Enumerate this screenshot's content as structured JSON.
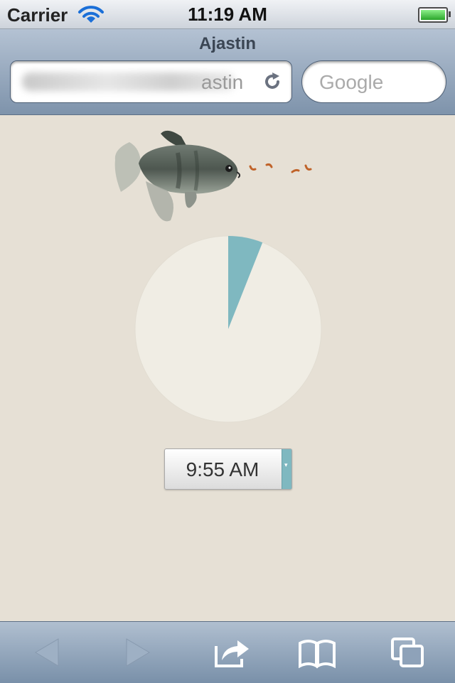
{
  "status_bar": {
    "carrier": "Carrier",
    "time": "11:19 AM",
    "icons": [
      "wifi-icon",
      "battery-icon"
    ]
  },
  "browser": {
    "page_title": "Ajastin",
    "address": {
      "visible_text": "astin",
      "icon": "reload-icon"
    },
    "search": {
      "placeholder": "Google"
    }
  },
  "app": {
    "illustration": "fish-eating-food",
    "timer": {
      "fraction_elapsed": 0.06,
      "remaining_color": "#f0ede4",
      "elapsed_color": "#7fb8c0"
    },
    "time_select": {
      "value": "9:55 AM"
    }
  },
  "toolbar": {
    "buttons": [
      "back-icon",
      "forward-icon",
      "share-icon",
      "bookmarks-icon",
      "tabs-icon"
    ]
  },
  "colors": {
    "background": "#e6e0d5",
    "accent": "#7fb8c0",
    "toolbar": "#8fa3ba"
  }
}
